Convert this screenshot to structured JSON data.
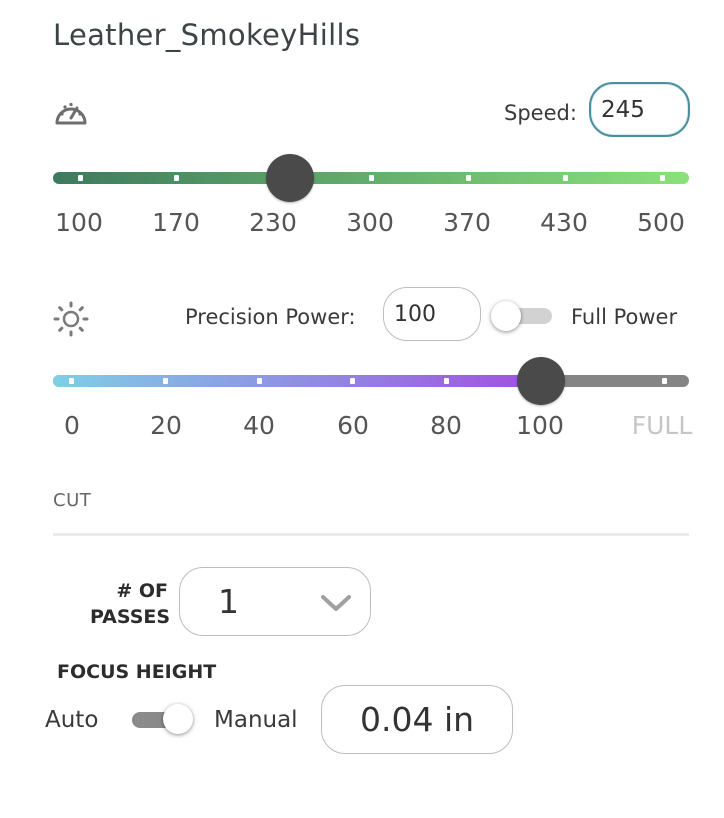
{
  "material": {
    "title": "Leather_SmokeyHills"
  },
  "speed": {
    "icon": "speedometer-icon",
    "label": "Speed:",
    "value": "245",
    "min": 100,
    "max": 500,
    "ticks": [
      "100",
      "170",
      "230",
      "300",
      "370",
      "430",
      "500"
    ],
    "gradient": [
      "#3e7a5e",
      "#8ae27a"
    ]
  },
  "power": {
    "icon": "sun-icon",
    "label": "Precision Power:",
    "value": "100",
    "toggle_label": "Full Power",
    "full_power_on": false,
    "ticks": [
      "0",
      "20",
      "40",
      "60",
      "80",
      "100",
      "FULL"
    ],
    "gradient": [
      "#7ecfe6",
      "#a24fe0"
    ]
  },
  "cut": {
    "section_label": "CUT",
    "passes_label_line1": "# OF",
    "passes_label_line2": "PASSES",
    "passes_value": "1",
    "chevron_icon": "chevron-down-icon"
  },
  "focus": {
    "label": "FOCUS HEIGHT",
    "auto_label": "Auto",
    "manual_label": "Manual",
    "manual_on": true,
    "value": "0.04 in"
  }
}
